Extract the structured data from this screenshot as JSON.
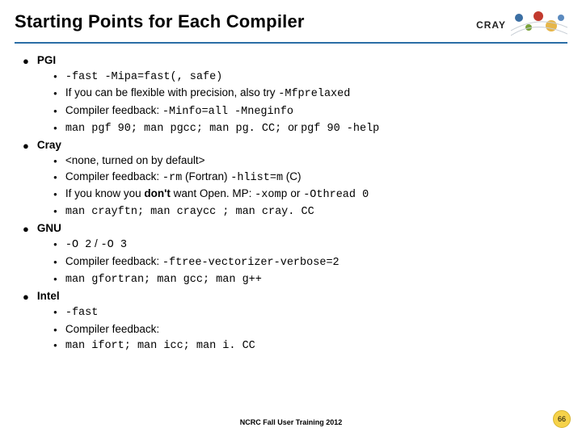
{
  "title": "Starting Points for Each Compiler",
  "logo_text": "CRAY",
  "sections": [
    {
      "name": "PGI",
      "items": [
        {
          "segments": [
            {
              "t": "-fast -Mipa=fast(, safe)",
              "mono": true
            }
          ]
        },
        {
          "segments": [
            {
              "t": "If you can be flexible with precision, also try "
            },
            {
              "t": "-Mfprelaxed",
              "mono": true
            }
          ]
        },
        {
          "segments": [
            {
              "t": "Compiler feedback: "
            },
            {
              "t": "-Minfo=all -Mneginfo",
              "mono": true
            }
          ]
        },
        {
          "segments": [
            {
              "t": "man pgf 90; man pgcc; man pg. CC; ",
              "mono": true
            },
            {
              "t": "or "
            },
            {
              "t": "pgf 90 -help",
              "mono": true
            }
          ]
        }
      ]
    },
    {
      "name": "Cray",
      "items": [
        {
          "segments": [
            {
              "t": "<none, turned on by default>"
            }
          ]
        },
        {
          "segments": [
            {
              "t": "Compiler feedback: "
            },
            {
              "t": "-rm",
              "mono": true
            },
            {
              "t": " (Fortran) "
            },
            {
              "t": "-hlist=m",
              "mono": true
            },
            {
              "t": " (C)"
            }
          ]
        },
        {
          "segments": [
            {
              "t": "If you know you "
            },
            {
              "t": "don't",
              "bold": true
            },
            {
              "t": " want Open. MP: "
            },
            {
              "t": "-xomp",
              "mono": true
            },
            {
              "t": " or "
            },
            {
              "t": "-Othread 0",
              "mono": true
            }
          ]
        },
        {
          "segments": [
            {
              "t": "man crayftn; man craycc ; man cray. CC",
              "mono": true
            }
          ]
        }
      ]
    },
    {
      "name": "GNU",
      "items": [
        {
          "segments": [
            {
              "t": "-O 2",
              "mono": true
            },
            {
              "t": " / "
            },
            {
              "t": "-O 3",
              "mono": true
            }
          ]
        },
        {
          "segments": [
            {
              "t": "Compiler feedback: "
            },
            {
              "t": "-ftree-vectorizer-verbose=2",
              "mono": true
            }
          ]
        },
        {
          "segments": [
            {
              "t": "man gfortran; man gcc; man g++",
              "mono": true
            }
          ]
        }
      ]
    },
    {
      "name": "Intel",
      "items": [
        {
          "segments": [
            {
              "t": "-fast",
              "mono": true
            }
          ]
        },
        {
          "segments": [
            {
              "t": "Compiler feedback:"
            }
          ]
        },
        {
          "segments": [
            {
              "t": "man ifort; man icc; man i. CC",
              "mono": true
            }
          ]
        }
      ]
    }
  ],
  "footer": "NCRC Fall User Training 2012",
  "page_no": "66"
}
